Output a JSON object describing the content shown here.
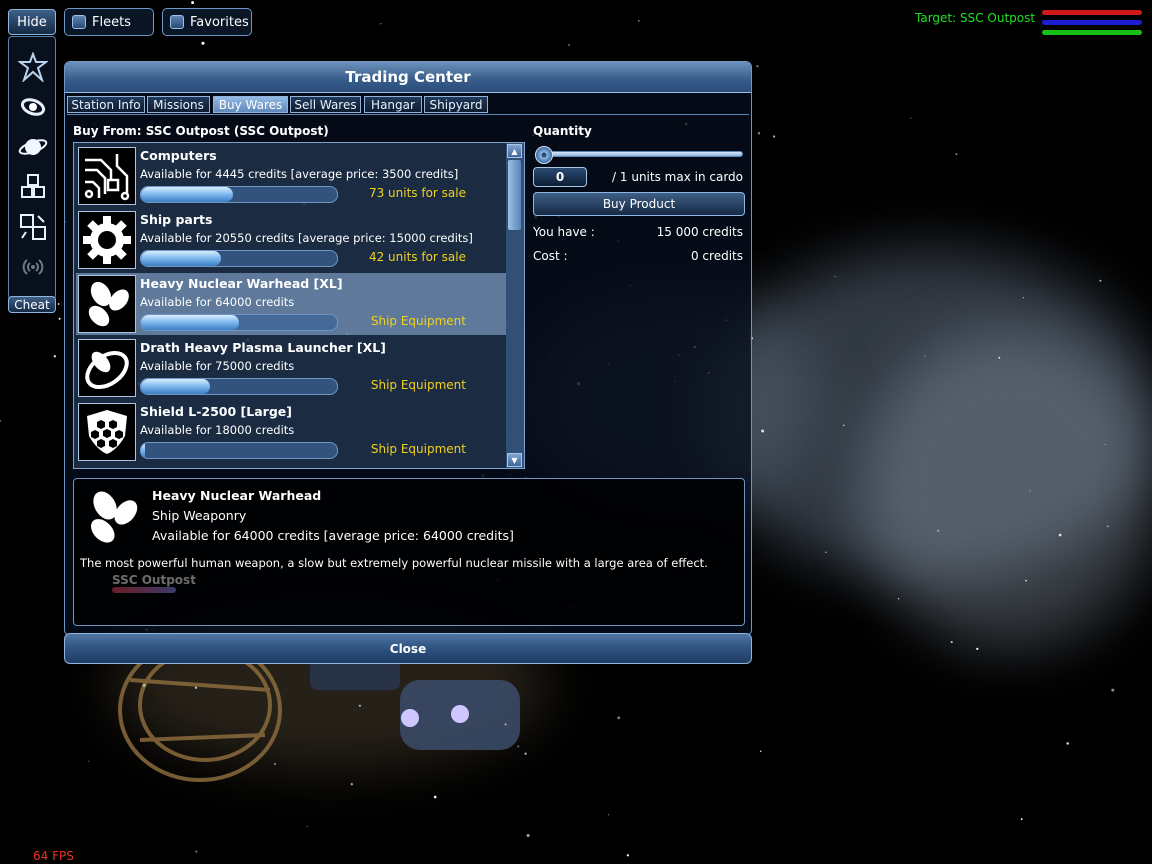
{
  "top_controls": {
    "hide_label": "Hide",
    "fleets_label": "Fleets",
    "favorites_label": "Favorites",
    "cheat_label": "Cheat",
    "fleets_checked": false,
    "favorites_checked": false
  },
  "sidebar": {
    "icons": [
      "fleet-emblem-icon",
      "galaxy-map-icon",
      "planet-icon",
      "cargo-crates-icon",
      "trade-exchange-icon",
      "signal-waves-icon"
    ]
  },
  "hud": {
    "target": "Target: SSC Outpost",
    "bar_colors": [
      "#d01818",
      "#1c1cd0",
      "#18c018"
    ]
  },
  "window": {
    "title": "Trading Center",
    "tabs": [
      "Station Info",
      "Missions",
      "Buy Wares",
      "Sell Wares",
      "Hangar",
      "Shipyard"
    ],
    "active_tab": "Buy Wares",
    "buy_from": "Buy From: SSC Outpost (SSC Outpost)"
  },
  "wares": [
    {
      "name": "Computers",
      "price": "Available for 4445 credits [average price: 3500 credits]",
      "stock": "73 units for sale",
      "level": 0.47,
      "icon": "circuit-board-icon",
      "selected": false
    },
    {
      "name": "Ship parts",
      "price": "Available for 20550 credits [average price: 15000 credits]",
      "stock": "42 units for sale",
      "level": 0.41,
      "icon": "gear-icon",
      "selected": false
    },
    {
      "name": "Heavy Nuclear Warhead [XL]",
      "price": "Available for 64000 credits",
      "stock": "Ship Equipment",
      "level": 0.5,
      "icon": "warhead-icon",
      "selected": true
    },
    {
      "name": "Drath Heavy Plasma Launcher [XL]",
      "price": "Available for 75000 credits",
      "stock": "Ship Equipment",
      "level": 0.35,
      "icon": "plasma-launcher-icon",
      "selected": false
    },
    {
      "name": "Shield L-2500 [Large]",
      "price": "Available for 18000 credits",
      "stock": "Ship Equipment",
      "level": 0.02,
      "icon": "shield-icon",
      "selected": false
    }
  ],
  "quantity": {
    "label": "Quantity",
    "value": "0",
    "max_text": "/ 1 units max in cardo",
    "buy_label": "Buy Product",
    "you_have_label": "You have :",
    "you_have_value": "15 000 credits",
    "cost_label": "Cost :",
    "cost_value": "0 credits"
  },
  "detail": {
    "name": "Heavy Nuclear Warhead",
    "category": "Ship Weaponry",
    "price": "Available for 64000 credits [average price: 64000 credits]",
    "description": "The most powerful human weapon, a slow but extremely powerful nuclear missile with a large area of effect.",
    "ghost_label": "SSC Outpost"
  },
  "close_label": "Close",
  "fps": "64 FPS"
}
